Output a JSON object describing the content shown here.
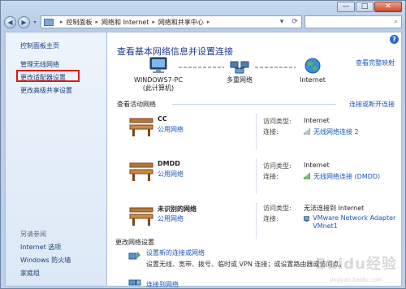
{
  "window": {
    "controls": {
      "minimize": "—",
      "maximize": "□",
      "close": "✕"
    }
  },
  "toolbar": {
    "back_icon": "◀",
    "forward_icon": "▶",
    "dropdown_icon": "▾",
    "breadcrumbs": [
      "控制面板",
      "网络和 Internet",
      "网络和共享中心"
    ],
    "refresh_icon": "⟳",
    "search_icon": "⌕"
  },
  "sidebar": {
    "home": "控制面板主页",
    "items": [
      {
        "label": "管理无线网络"
      },
      {
        "label": "更改适配器设置"
      },
      {
        "label": "更改高级共享设置"
      }
    ],
    "see_also_header": "另请参阅",
    "see_also": [
      {
        "label": "Internet 选项"
      },
      {
        "label": "Windows 防火墙"
      },
      {
        "label": "家庭组"
      }
    ]
  },
  "main": {
    "help": "?",
    "title": "查看基本网络信息并设置连接",
    "see_full_map": "查看完整映射",
    "map": {
      "computer_name": "WINDOWS7-PC",
      "computer_sub": "(此计算机)",
      "multi_network": "多重网络",
      "internet": "Internet"
    },
    "active_networks_header": "查看活动网络",
    "connect_disconnect": "连接或断开连接",
    "networks": [
      {
        "name": "CC",
        "type": "公用网络",
        "access_type_label": "访问类型:",
        "access_type": "Internet",
        "connection_label": "连接:",
        "connection": "无线网络连接 2",
        "connection_icon": "wireless-bars-icon"
      },
      {
        "name": "DMDD",
        "type": "公用网络",
        "access_type_label": "访问类型:",
        "access_type": "Internet",
        "connection_label": "连接:",
        "connection": "无线网络连接 (DMDD)",
        "connection_icon": "wireless-signal-icon"
      },
      {
        "name": "未识别的网络",
        "type": "公用网络",
        "access_type_label": "访问类型:",
        "access_type": "无法连接到 Internet",
        "connection_label": "连接:",
        "connection": "VMware Network Adapter VMnet1",
        "connection_icon": "network-adapter-icon"
      }
    ],
    "change_settings_header": "更改网络设置",
    "setup_link": "设置新的连接或网络",
    "setup_desc": "设置无线、宽带、拨号、临时或 VPN 连接；或设置路由器或访问点。",
    "connect_link": "连接到网络"
  },
  "watermark": {
    "text": "Baidu经验",
    "sub": "jingyan.baidu.com"
  },
  "colors": {
    "link": "#1a57b8",
    "title": "#1e3a8c",
    "highlight": "#e21616"
  }
}
